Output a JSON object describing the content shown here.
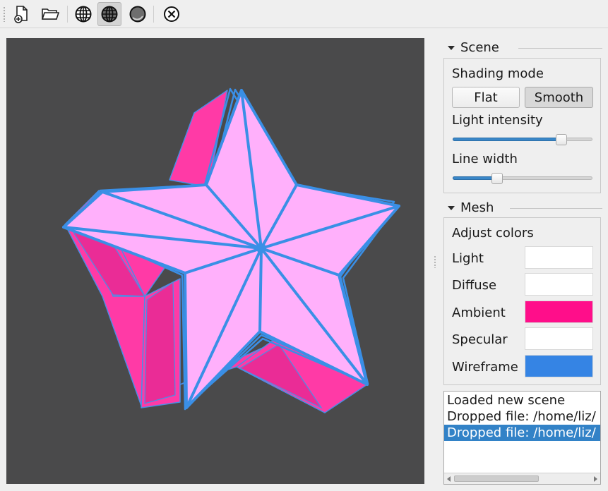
{
  "toolbar": {
    "icons": [
      "new-file-icon",
      "open-folder-icon",
      "wireframe-globe-icon",
      "wireframe-overlay-icon",
      "solid-sphere-icon",
      "close-circle-icon"
    ]
  },
  "scene": {
    "title": "Scene",
    "shading_mode_label": "Shading mode",
    "flat_label": "Flat",
    "smooth_label": "Smooth",
    "selected_shading": "Smooth",
    "light_intensity_label": "Light intensity",
    "light_intensity_value": 0.78,
    "line_width_label": "Line width",
    "line_width_value": 0.32
  },
  "mesh": {
    "title": "Mesh",
    "adjust_colors_label": "Adjust colors",
    "colors": [
      {
        "label": "Light",
        "color": "#ffffff"
      },
      {
        "label": "Diffuse",
        "color": "#ffffff"
      },
      {
        "label": "Ambient",
        "color": "#ff0e8a"
      },
      {
        "label": "Specular",
        "color": "#ffffff"
      },
      {
        "label": "Wireframe",
        "color": "#3584e4"
      }
    ]
  },
  "log": {
    "items": [
      {
        "text": "Loaded new scene",
        "selected": false
      },
      {
        "text": "Dropped file: /home/liz/",
        "selected": false
      },
      {
        "text": "Dropped file: /home/liz/",
        "selected": true
      }
    ]
  },
  "colors": {
    "viewport_bg": "#4a4a4b",
    "star_face": "#ffb0fb",
    "star_side": "#ff3aa6",
    "wire": "#3a8fe6",
    "accent": "#3282c7"
  }
}
